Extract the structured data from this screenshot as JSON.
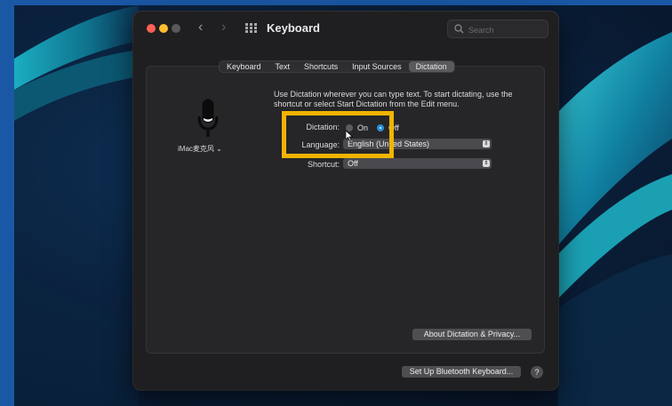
{
  "window": {
    "title": "Keyboard",
    "search_placeholder": "Search"
  },
  "tabs": [
    {
      "label": "Keyboard",
      "active": false
    },
    {
      "label": "Text",
      "active": false
    },
    {
      "label": "Shortcuts",
      "active": false
    },
    {
      "label": "Input Sources",
      "active": false
    },
    {
      "label": "Dictation",
      "active": true
    }
  ],
  "mic": {
    "label": "iMac麦克风 ⌄"
  },
  "dictation": {
    "description": "Use Dictation wherever you can type text. To start dictating, use the shortcut or select Start Dictation from the Edit menu.",
    "dictation_label": "Dictation:",
    "on_label": "On",
    "off_label": "Off",
    "selected": "Off",
    "language_label": "Language:",
    "language_value": "English (United States)",
    "shortcut_label": "Shortcut:",
    "shortcut_value": "Off"
  },
  "buttons": {
    "about": "About Dictation & Privacy...",
    "bluetooth": "Set Up Bluetooth Keyboard...",
    "help": "?"
  },
  "colors": {
    "highlight": "#f0b400",
    "selected_radio": "#2a8fd8",
    "close": "#ff5f57",
    "minimize": "#febc2e"
  }
}
